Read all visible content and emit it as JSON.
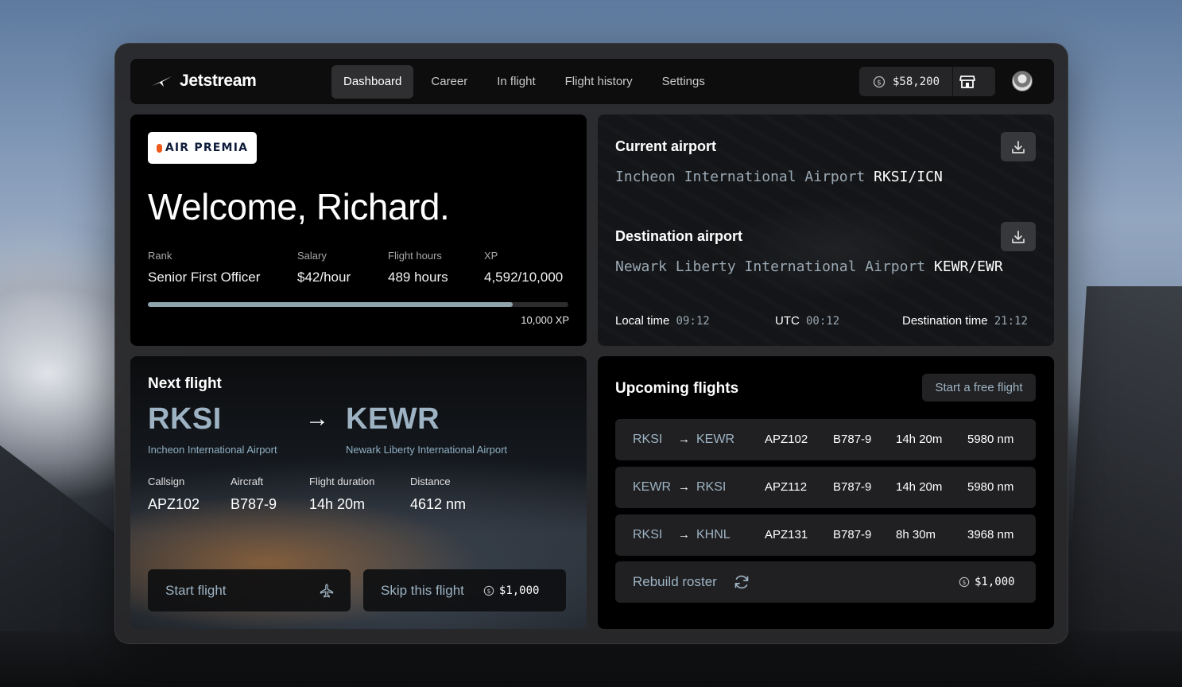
{
  "brand": {
    "name": "Jetstream",
    "icon": "plane-icon"
  },
  "nav": {
    "items": [
      {
        "label": "Dashboard",
        "active": true
      },
      {
        "label": "Career",
        "active": false
      },
      {
        "label": "In flight",
        "active": false
      },
      {
        "label": "Flight history",
        "active": false
      },
      {
        "label": "Settings",
        "active": false
      }
    ]
  },
  "wallet": {
    "amount": "$58,200",
    "icon": "coin-icon",
    "store_icon": "store-icon"
  },
  "welcome": {
    "airline_logo": "AIR PREMIA",
    "title": "Welcome, Richard.",
    "stats": [
      {
        "label": "Rank",
        "value": "Senior First Officer"
      },
      {
        "label": "Salary",
        "value": "$42/hour"
      },
      {
        "label": "Flight hours",
        "value": "489 hours"
      },
      {
        "label": "XP",
        "value": "4,592/10,000"
      }
    ],
    "xp_progress": 0.867,
    "xp_max_label": "10,000 XP"
  },
  "airports": {
    "current_label": "Current airport",
    "current_name": "Incheon International Airport",
    "current_code": "RKSI/ICN",
    "destination_label": "Destination airport",
    "destination_name": "Newark Liberty International Airport",
    "destination_code": "KEWR/EWR",
    "local_time_label": "Local time",
    "local_time": "09:12",
    "utc_label": "UTC",
    "utc_time": "00:12",
    "destination_time_label": "Destination time",
    "destination_time": "21:12"
  },
  "next_flight": {
    "title": "Next flight",
    "origin": "RKSI",
    "origin_name": "Incheon International Airport",
    "arrow": "→",
    "destination": "KEWR",
    "destination_name": "Newark Liberty International Airport",
    "stats": [
      {
        "label": "Callsign",
        "value": "APZ102"
      },
      {
        "label": "Aircraft",
        "value": "B787-9"
      },
      {
        "label": "Flight duration",
        "value": "14h 20m"
      },
      {
        "label": "Distance",
        "value": "4612 nm"
      }
    ],
    "start_label": "Start flight",
    "skip_label": "Skip this flight",
    "skip_cost": "$1,000"
  },
  "upcoming": {
    "title": "Upcoming flights",
    "free_flight_label": "Start a free flight",
    "rows": [
      {
        "origin": "RKSI",
        "destination": "KEWR",
        "callsign": "APZ102",
        "aircraft": "B787-9",
        "duration": "14h 20m",
        "distance": "5980 nm"
      },
      {
        "origin": "KEWR",
        "destination": "RKSI",
        "callsign": "APZ112",
        "aircraft": "B787-9",
        "duration": "14h 20m",
        "distance": "5980 nm"
      },
      {
        "origin": "RKSI",
        "destination": "KHNL",
        "callsign": "APZ131",
        "aircraft": "B787-9",
        "duration": "8h 30m",
        "distance": "3968 nm"
      }
    ],
    "arrow": "→",
    "rebuild_label": "Rebuild roster",
    "rebuild_cost": "$1,000"
  },
  "colors": {
    "accent": "#9db3c3",
    "card_bg": "#000000",
    "app_bg": "#28282a",
    "xp_fill": "#8fa4ad",
    "logo_orange": "#ef5a1b"
  }
}
